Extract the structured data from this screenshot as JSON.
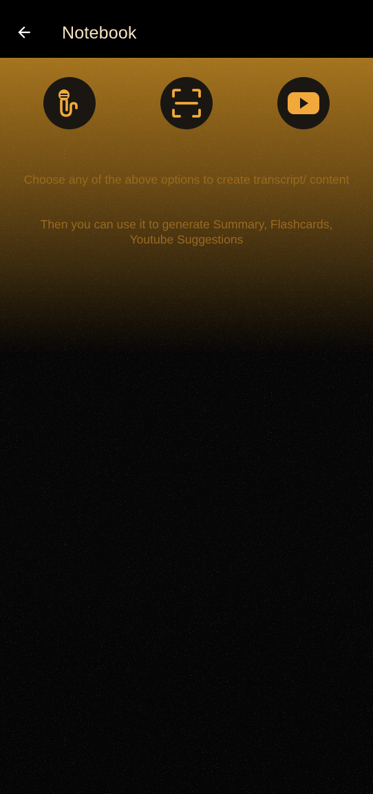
{
  "header": {
    "title": "Notebook",
    "back_icon": "arrow-left-icon"
  },
  "actions": [
    {
      "icon": "microphone-icon"
    },
    {
      "icon": "scan-icon"
    },
    {
      "icon": "youtube-icon"
    }
  ],
  "hints": {
    "line1": "Choose any of the above options to create transcript/ content",
    "line2": "Then you can use it to generate Summary, Flashcards, Youtube Suggestions"
  },
  "colors": {
    "accent": "#f2a93b",
    "header_bg": "#000000",
    "title_text": "#f6e3c3",
    "hint_text": "#9a6a1e",
    "button_bg": "#1a1712"
  }
}
